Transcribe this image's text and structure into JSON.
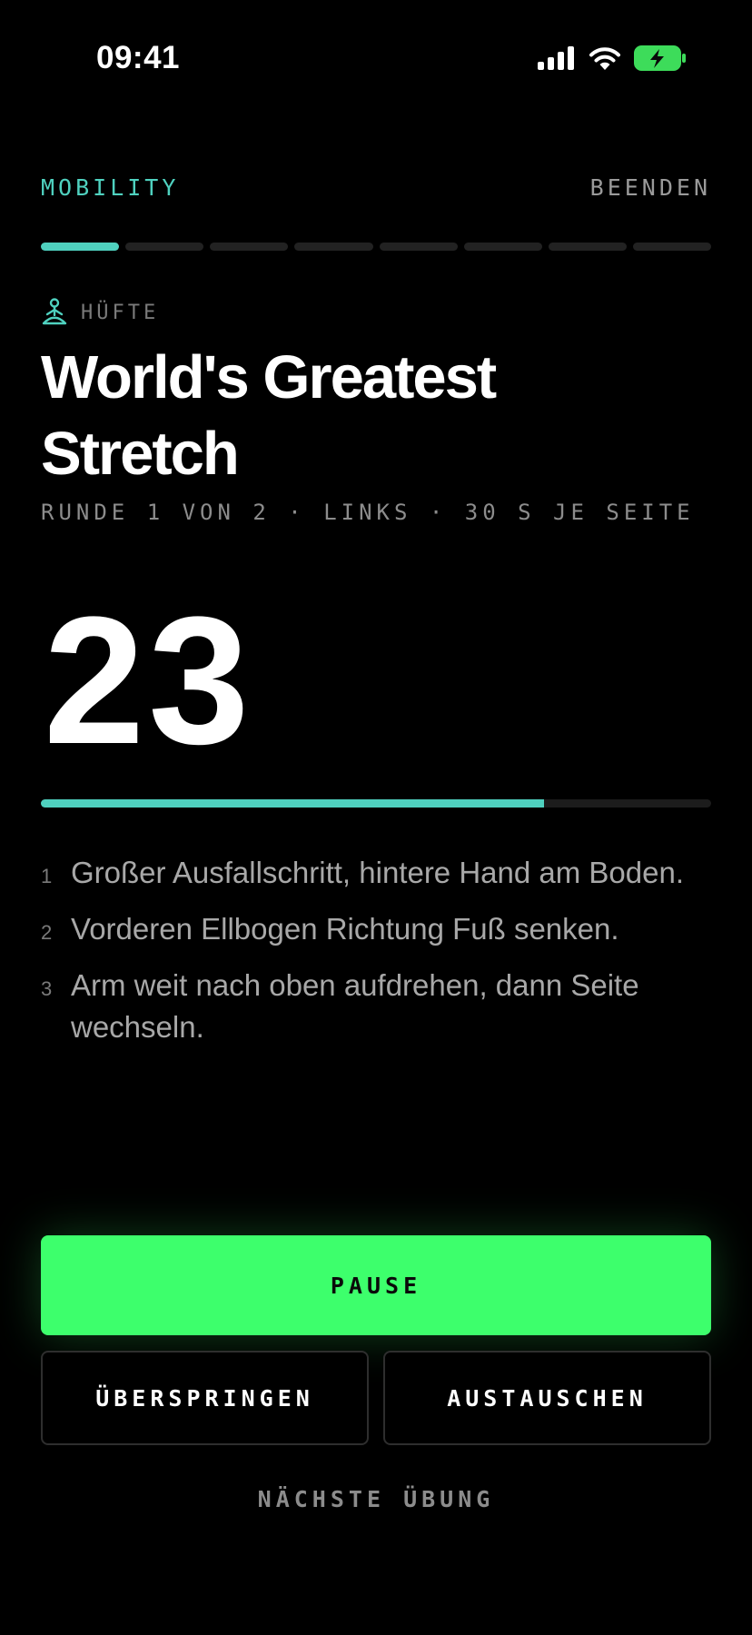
{
  "status_bar": {
    "time": "09:41",
    "icons": [
      "cellular-signal-icon",
      "wifi-icon",
      "battery-charging-icon"
    ]
  },
  "header": {
    "category": "MOBILITY",
    "end_label": "BEENDEN"
  },
  "segments": {
    "total": 8,
    "active": 1
  },
  "exercise": {
    "muscle_icon": "meditation-pose-icon",
    "muscle_group": "HÜFTE",
    "title_line1": "World's Greatest",
    "title_line2": "Stretch",
    "meta": "RUNDE 1 VON 2 · LINKS · 30 S JE SEITE",
    "timer": "23",
    "progress_fraction": 0.75,
    "steps": [
      {
        "num": "1",
        "text": "Großer Ausfallschritt, hintere Hand am Boden."
      },
      {
        "num": "2",
        "text": "Vorderen Ellbogen Richtung Fuß senken."
      },
      {
        "num": "3",
        "text": "Arm weit nach oben aufdrehen, dann Seite wechseln."
      }
    ]
  },
  "actions": {
    "pause_label": "PAUSE",
    "skip_label": "ÜBERSPRINGEN",
    "swap_label": "AUSTAUSCHEN",
    "next_label": "NÄCHSTE ÜBUNG"
  },
  "colors": {
    "accent": "#4fd1bf",
    "primary_button": "#3dff6c",
    "battery": "#3ddc5a",
    "background": "#000000"
  }
}
